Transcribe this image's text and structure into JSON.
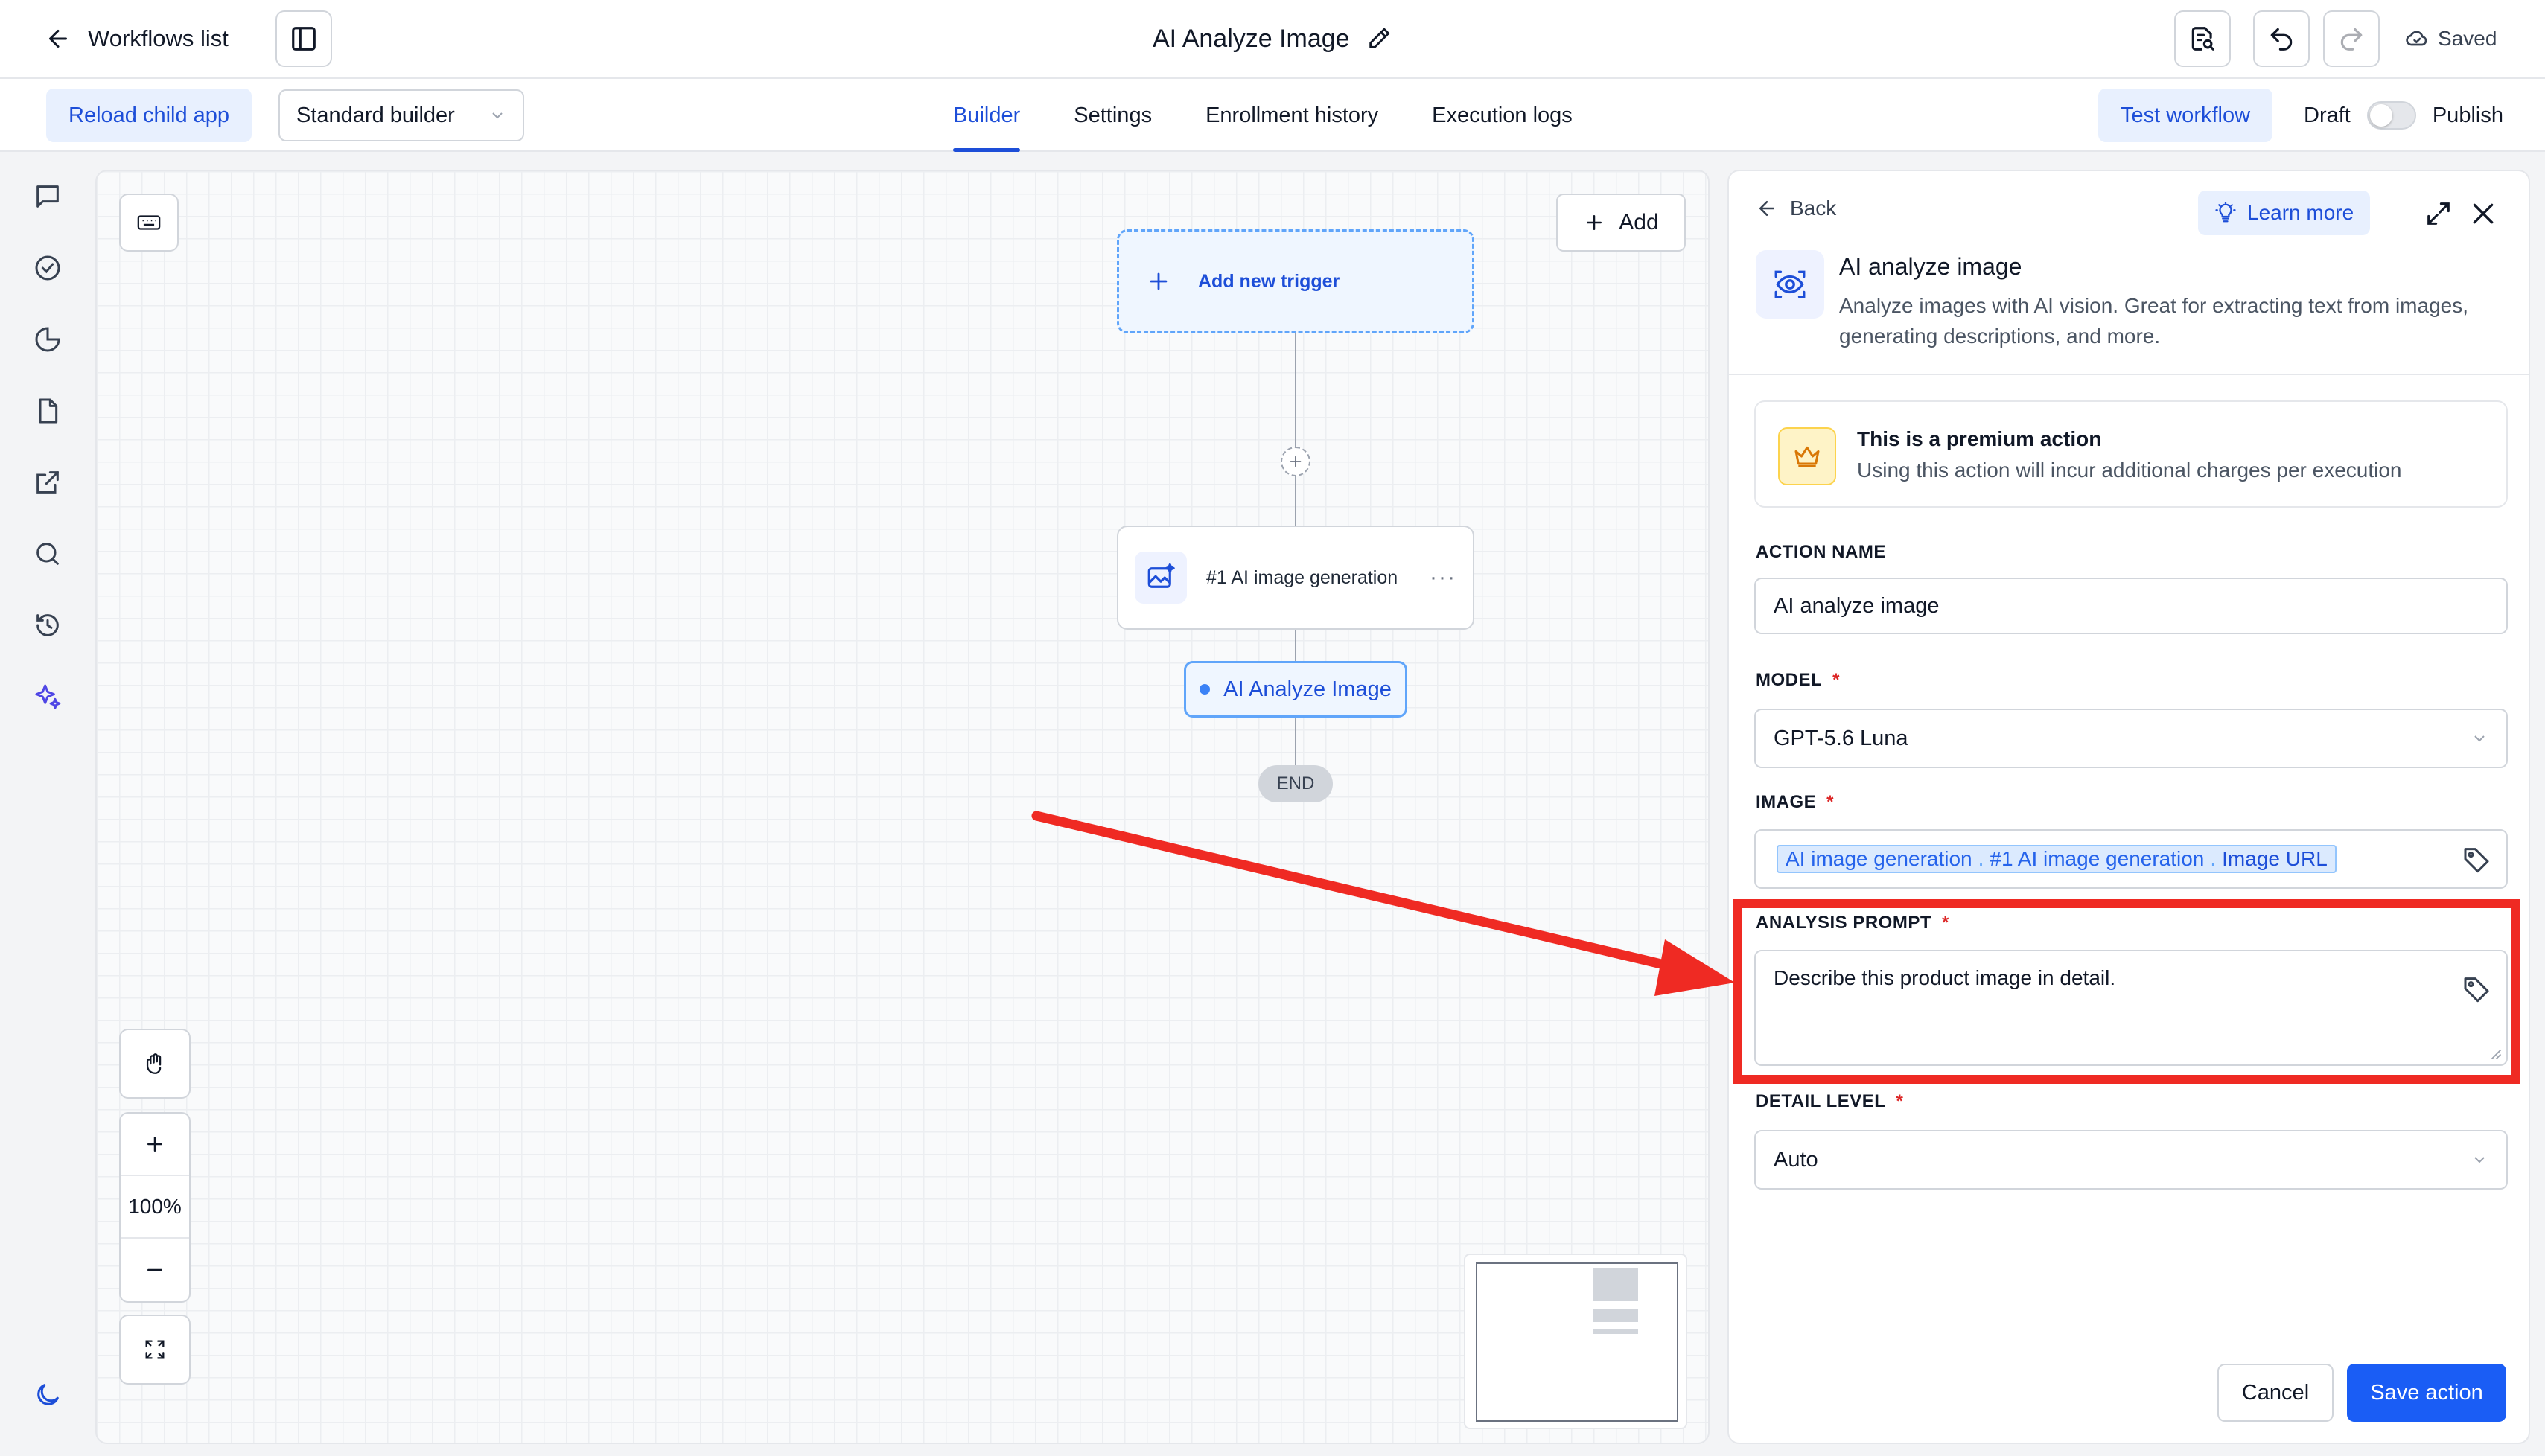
{
  "topbar": {
    "back_label": "Workflows list",
    "title": "AI Analyze Image",
    "saved_label": "Saved"
  },
  "subbar": {
    "reload_label": "Reload child app",
    "builder_select": "Standard builder",
    "tabs": [
      {
        "label": "Builder",
        "active": true
      },
      {
        "label": "Settings",
        "active": false
      },
      {
        "label": "Enrollment history",
        "active": false
      },
      {
        "label": "Execution logs",
        "active": false
      }
    ],
    "test_label": "Test workflow",
    "draft_label": "Draft",
    "publish_label": "Publish"
  },
  "rail": {
    "icons": [
      "chat-icon",
      "check-circle-icon",
      "pie-chart-icon",
      "file-icon",
      "external-link-icon",
      "search-icon",
      "history-icon",
      "sparkles-icon",
      "moon-icon"
    ]
  },
  "canvas": {
    "add_label": "Add",
    "trigger_label": "Add new trigger",
    "step_label": "#1 AI image generation",
    "step_more": "···",
    "selected_node_label": "AI Analyze Image",
    "end_label": "END",
    "zoom_level": "100%"
  },
  "panel": {
    "back_label": "Back",
    "learn_more_label": "Learn more",
    "action_title": "AI analyze image",
    "action_description": "Analyze images with AI vision. Great for extracting text from images, generating descriptions, and more.",
    "premium_title": "This is a premium action",
    "premium_description": "Using this action will incur additional charges per execution",
    "fields": {
      "action_name_label": "ACTION NAME",
      "action_name_value": "AI analyze image",
      "model_label": "MODEL",
      "model_value": "GPT-5.6 Luna",
      "image_label": "IMAGE",
      "image_tag_parts": [
        "AI image generation",
        "#1 AI image generation",
        "Image URL"
      ],
      "image_tag_separator": ".",
      "prompt_label": "ANALYSIS PROMPT",
      "prompt_value": "Describe this product image in detail.",
      "detail_label": "DETAIL LEVEL",
      "detail_value": "Auto",
      "required_marker": "*"
    },
    "cancel_label": "Cancel",
    "save_label": "Save action"
  },
  "colors": {
    "accent": "#1d4ed8",
    "primary_button": "#1a5df5",
    "highlight_annotation": "#ef2a23",
    "premium_bg": "#fef3c7"
  }
}
